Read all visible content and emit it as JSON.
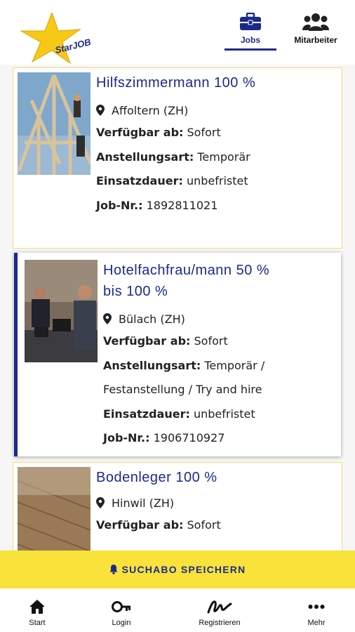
{
  "header": {
    "logo_text": "StarJOB",
    "tabs": [
      {
        "label": "Jobs",
        "icon": "briefcase-icon",
        "active": true
      },
      {
        "label": "Mitarbeiter",
        "icon": "people-icon",
        "active": false
      }
    ]
  },
  "jobs": [
    {
      "title": "Hilfszimmermann 100 %",
      "location": "Affoltern (ZH)",
      "fields": [
        {
          "label": "Verfügbar ab:",
          "value": "Sofort"
        },
        {
          "label": "Anstellungsart:",
          "value": "Temporär"
        },
        {
          "label": "Einsatzdauer:",
          "value": "unbefristet"
        },
        {
          "label": "Job-Nr.:",
          "value": "1892811021"
        }
      ]
    },
    {
      "title": "Hotelfachfrau/mann 50 % bis 100 %",
      "location": "Bülach (ZH)",
      "fields": [
        {
          "label": "Verfügbar ab:",
          "value": "Sofort"
        },
        {
          "label": "Anstellungsart:",
          "value": "Temporär /"
        },
        {
          "label": "",
          "value": "Festanstellung / Try and hire"
        },
        {
          "label": "Einsatzdauer:",
          "value": "unbefristet"
        },
        {
          "label": "Job-Nr.:",
          "value": "1906710927"
        }
      ]
    },
    {
      "title": "Bodenleger 100 %",
      "location": "Hinwil (ZH)",
      "fields": [
        {
          "label": "Verfügbar ab:",
          "value": "Sofort"
        }
      ]
    }
  ],
  "save_search": {
    "label": "SUCHABO SPEICHERN",
    "icon": "bell-icon"
  },
  "bottom_nav": [
    {
      "label": "Start",
      "icon": "home-icon"
    },
    {
      "label": "Login",
      "icon": "key-icon"
    },
    {
      "label": "Registrieren",
      "icon": "signature-icon"
    },
    {
      "label": "Mehr",
      "icon": "more-icon"
    }
  ],
  "colors": {
    "accent": "#1a2a8c",
    "brand_yellow": "#f9e23a",
    "card_border": "#f2dc78"
  }
}
